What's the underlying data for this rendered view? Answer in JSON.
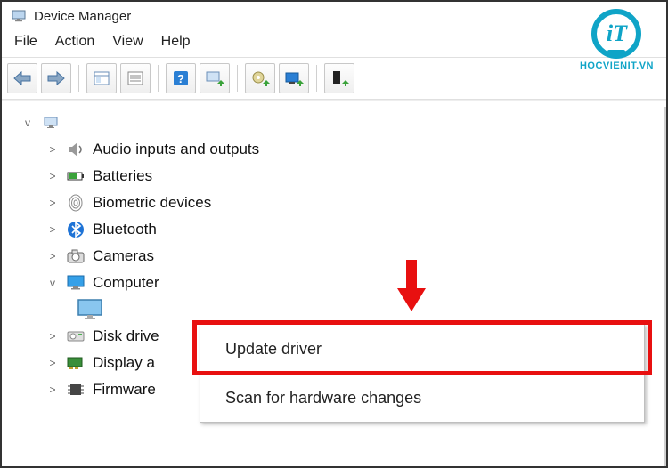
{
  "window": {
    "title": "Device Manager"
  },
  "menubar": [
    "File",
    "Action",
    "View",
    "Help"
  ],
  "toolbar_icons": [
    "back",
    "forward",
    "show-hidden",
    "properties",
    "help-topic",
    "scan",
    "update-driver",
    "uninstall",
    "add-legacy"
  ],
  "tree": {
    "root_expander": "v",
    "items": [
      {
        "label": "Audio inputs and outputs",
        "expander": ">",
        "icon": "speaker-icon"
      },
      {
        "label": "Batteries",
        "expander": ">",
        "icon": "battery-icon"
      },
      {
        "label": "Biometric devices",
        "expander": ">",
        "icon": "fingerprint-icon"
      },
      {
        "label": "Bluetooth",
        "expander": ">",
        "icon": "bluetooth-icon"
      },
      {
        "label": "Cameras",
        "expander": ">",
        "icon": "camera-icon"
      },
      {
        "label": "Computer",
        "expander": "v",
        "icon": "monitor-icon"
      },
      {
        "label": "Disk drive",
        "expander": ">",
        "icon": "disk-icon",
        "truncated": "Disk drive"
      },
      {
        "label": "Display a",
        "expander": ">",
        "icon": "display-adapter-icon"
      },
      {
        "label": "Firmware",
        "expander": ">",
        "icon": "firmware-icon"
      }
    ],
    "selected_child": {
      "icon": "monitor-selected-icon"
    }
  },
  "context_menu": {
    "items": [
      {
        "label": "Update driver"
      },
      {
        "label": "Scan for hardware changes"
      }
    ]
  },
  "logo": {
    "text": "iT",
    "caption": "HOCVIENIT.VN"
  }
}
